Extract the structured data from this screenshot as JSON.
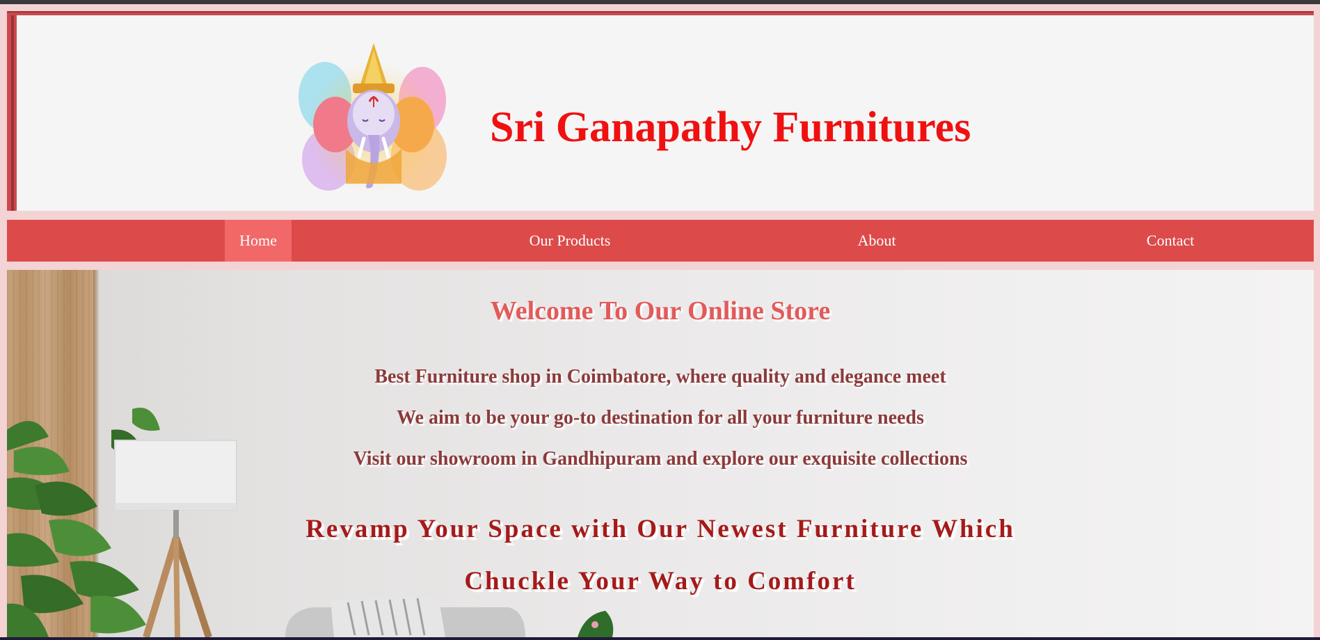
{
  "header": {
    "brand_title": "Sri Ganapathy Furnitures",
    "logo_icon": "ganesha-logo-icon"
  },
  "nav": {
    "items": [
      {
        "label": "Home",
        "active": true
      },
      {
        "label": "Our Products",
        "active": false
      },
      {
        "label": "About",
        "active": false
      },
      {
        "label": "Contact",
        "active": false
      }
    ]
  },
  "hero": {
    "welcome": "Welcome To Our Online Store",
    "taglines": [
      "Best Furniture shop in Coimbatore, where quality and elegance meet",
      "We aim to be your go-to destination for all your furniture needs",
      "Visit our showroom in Gandhipuram and explore our exquisite collections"
    ],
    "promo_line_1": "Revamp Your Space with Our Newest Furniture Which",
    "promo_line_2": "Chuckle Your Way to Comfort"
  },
  "colors": {
    "brand_red": "#ef1111",
    "nav_background": "#dc4a4a",
    "nav_active": "#f26868",
    "page_background": "#f3d3d3",
    "header_border": "#c94a4f",
    "welcome_text": "#e25a5a",
    "tagline_text": "#8b3a3a",
    "promo_text": "#a51a1a"
  }
}
